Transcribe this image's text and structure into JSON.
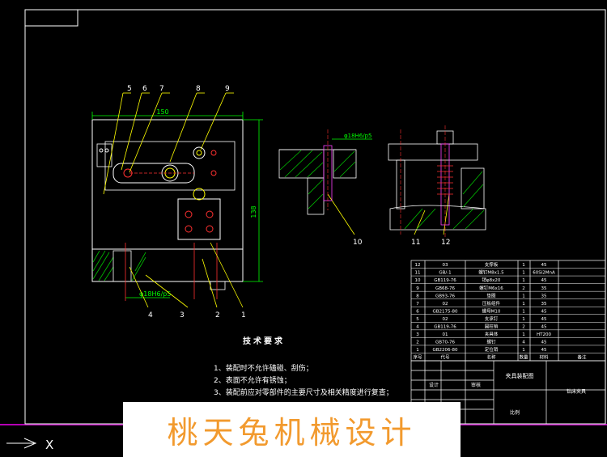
{
  "drawing": {
    "dimensions": {
      "width_label": "150",
      "height_label": "138",
      "fit_left": "φ18H6/p5",
      "fit_right": "φ18H6/p5"
    },
    "balloons": [
      "1",
      "2",
      "3",
      "4",
      "5",
      "6",
      "7",
      "8",
      "9",
      "10",
      "11",
      "12"
    ],
    "tech_requirements": {
      "title": "技术要求",
      "notes": [
        "1、装配时不允许磕碰、刮伤；",
        "2、表面不允许有锈蚀；",
        "3、装配前应对零部件的主要尺寸及相关精度进行复查；"
      ]
    },
    "parts_table": {
      "rows": [
        {
          "no": "12",
          "code": "03",
          "name": "支撑板",
          "qty": "1",
          "material": "45"
        },
        {
          "no": "11",
          "code": "GB/-1",
          "name": "螺钉M8x1.5",
          "qty": "1",
          "material": "60Si2MnA"
        },
        {
          "no": "10",
          "code": "GB119-76",
          "name": "销φ8x20",
          "qty": "1",
          "material": "45"
        },
        {
          "no": "9",
          "code": "GB68-76",
          "name": "螺钉M6x16",
          "qty": "2",
          "material": "35"
        },
        {
          "no": "8",
          "code": "GB93-76",
          "name": "垫圈",
          "qty": "1",
          "material": "35"
        },
        {
          "no": "7",
          "code": "02",
          "name": "压板组件",
          "qty": "1",
          "material": "35"
        },
        {
          "no": "6",
          "code": "GB2175-80",
          "name": "螺母M10",
          "qty": "1",
          "material": "45"
        },
        {
          "no": "5",
          "code": "02",
          "name": "支承钉",
          "qty": "1",
          "material": "45"
        },
        {
          "no": "4",
          "code": "GB119-76",
          "name": "圆柱销",
          "qty": "2",
          "material": "45"
        },
        {
          "no": "3",
          "code": "01",
          "name": "夹具体",
          "qty": "1",
          "material": "HT200"
        },
        {
          "no": "2",
          "code": "GB70-76",
          "name": "螺钉",
          "qty": "4",
          "material": "45"
        },
        {
          "no": "1",
          "code": "GB2206-80",
          "name": "定位销",
          "qty": "1",
          "material": "45"
        }
      ],
      "header": {
        "no": "序号",
        "code": "代号",
        "name": "名称",
        "qty": "数量",
        "material": "材料",
        "remark": "备注"
      }
    },
    "title_block": {
      "drawing_name": "夹具装配图",
      "company": "钻床夹具",
      "drawn": "设计",
      "checked": "审核",
      "scale": "比例"
    }
  },
  "watermark": {
    "text": "桃天兔机械设计"
  },
  "ucs": {
    "x_label": "X"
  },
  "colors": {
    "background": "#000000",
    "frame": "#ffffff",
    "border": "#b400b4",
    "part_line": "#ffffff",
    "dimension": "#00ff00",
    "leader": "#ffff00",
    "hatch": "#00c000",
    "watermark": "#f29a2e",
    "accent_red": "#ff3030",
    "accent_magenta": "#ff40ff"
  }
}
